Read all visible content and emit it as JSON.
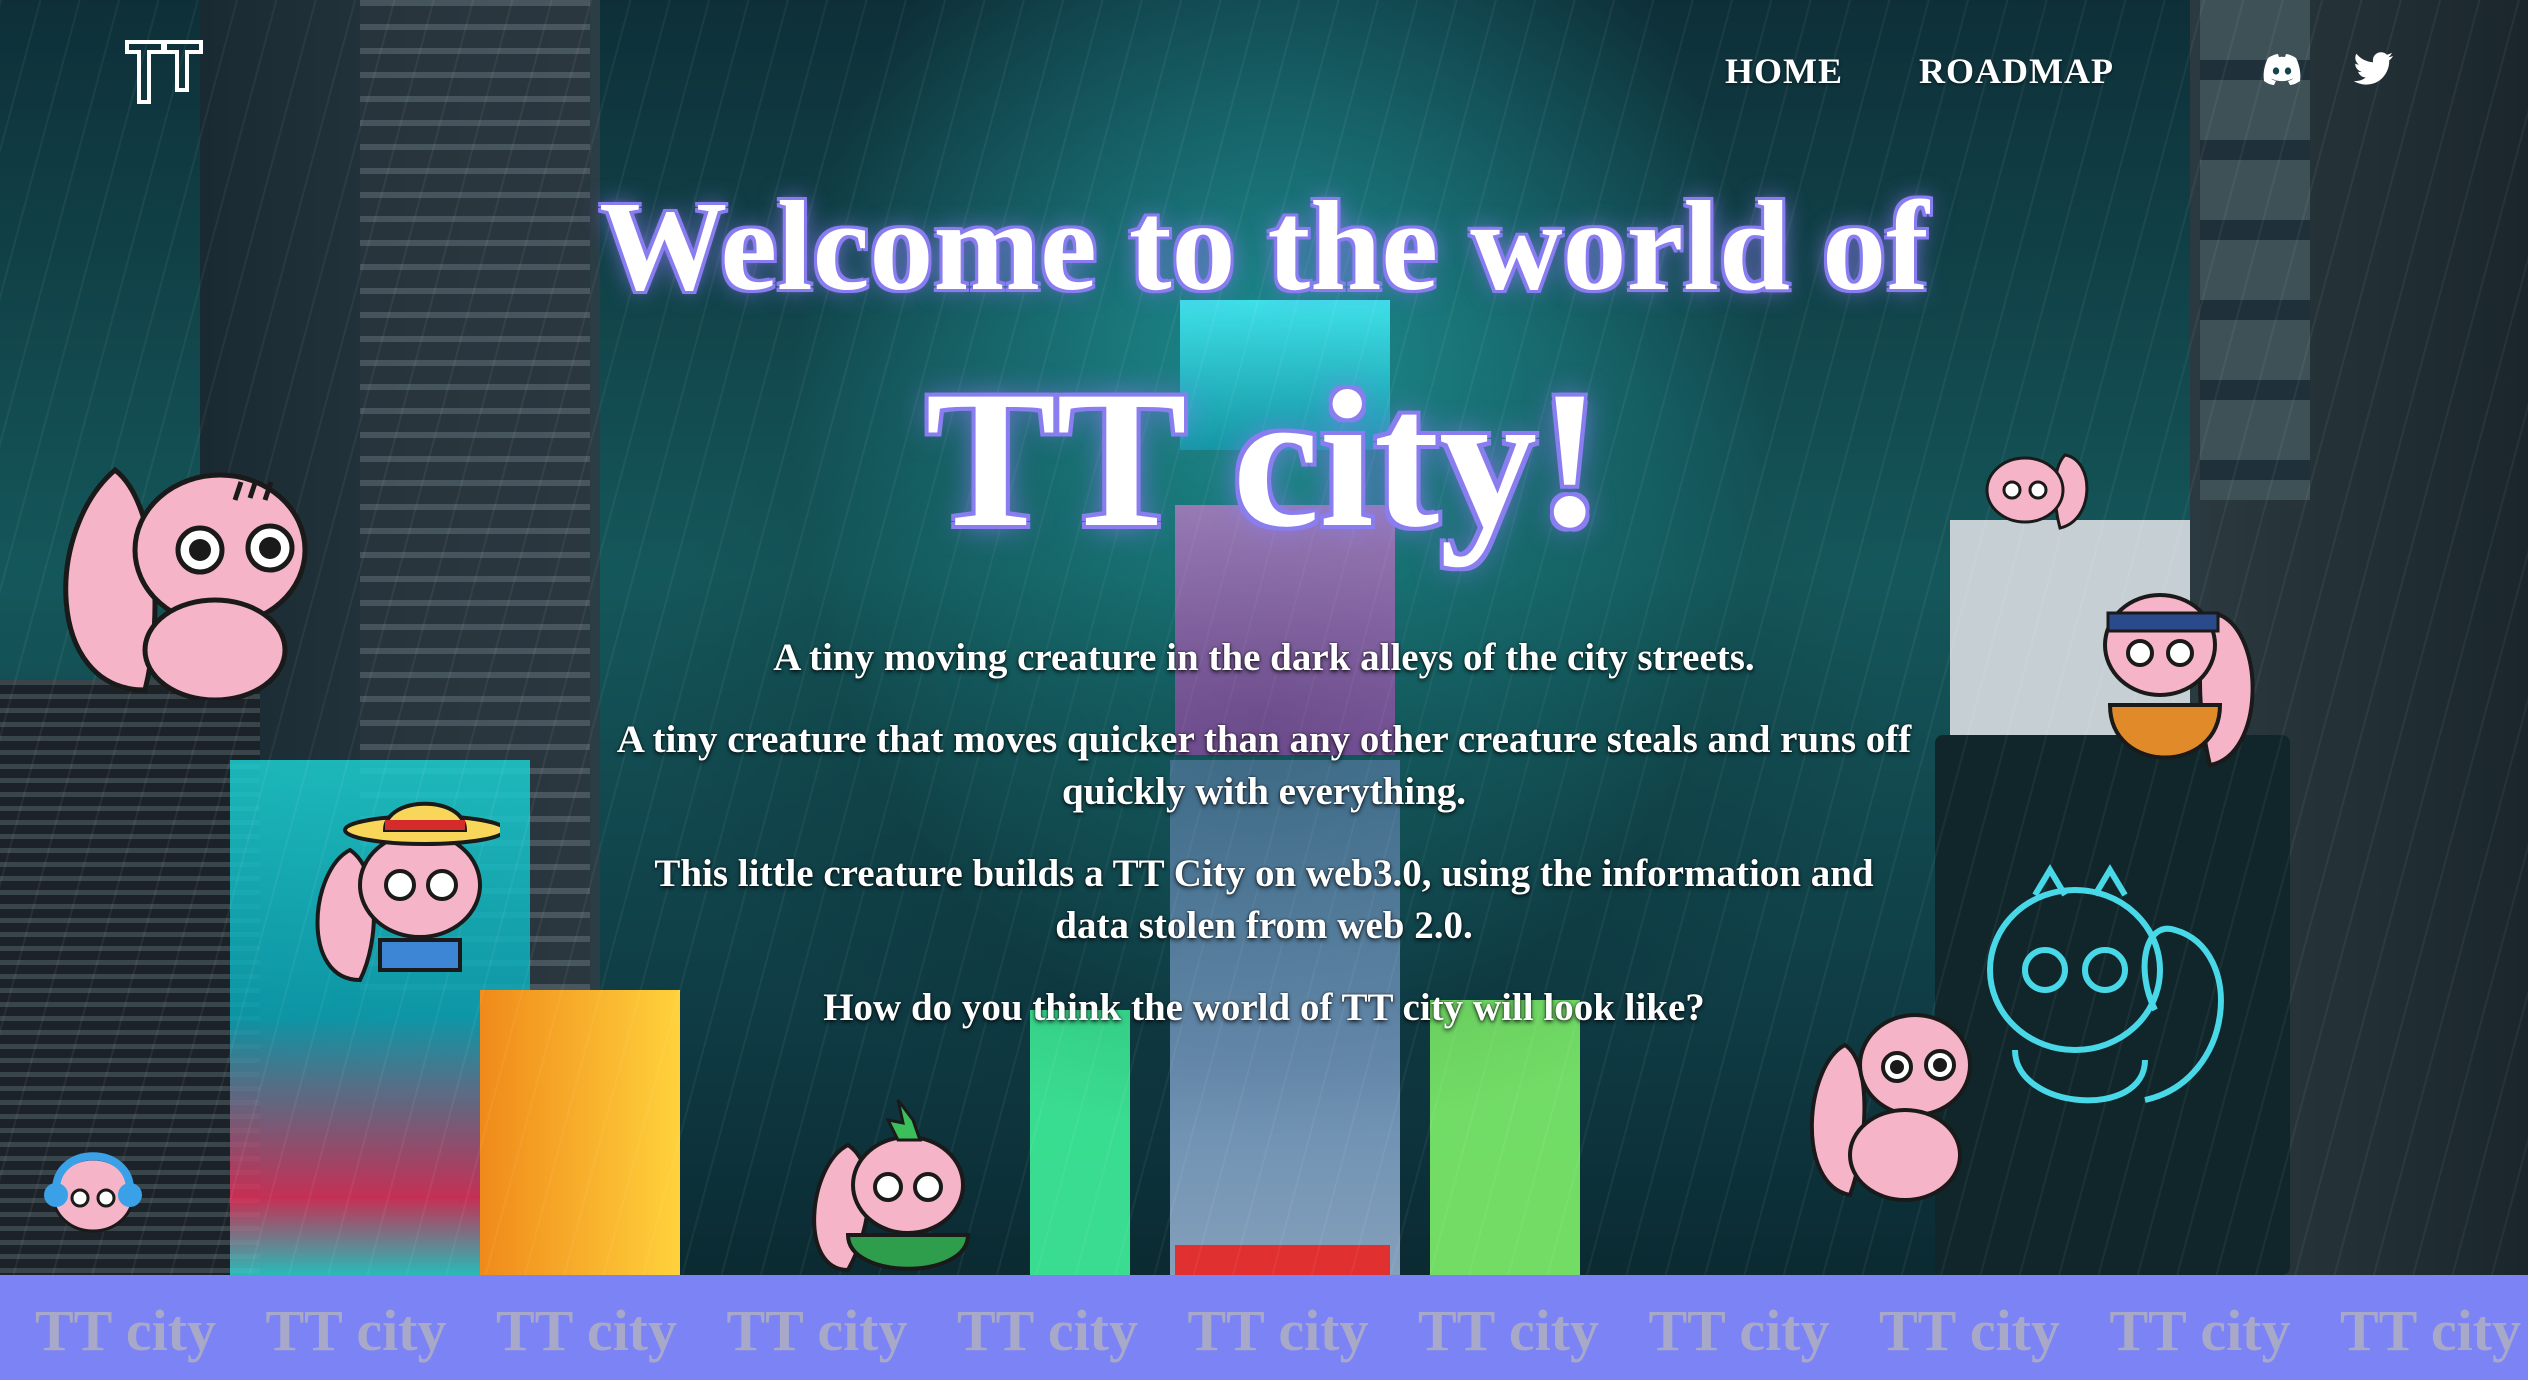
{
  "nav": {
    "logo_icon": "tt-logo-icon",
    "links": [
      {
        "label": "HOME"
      },
      {
        "label": "ROADMAP"
      }
    ],
    "social": [
      {
        "icon": "discord-icon"
      },
      {
        "icon": "twitter-icon"
      }
    ]
  },
  "hero": {
    "line1": "Welcome to the world of",
    "line2": "TT city!",
    "paragraphs": [
      "A tiny moving creature in the dark alleys of the city streets.",
      "A tiny creature that moves quicker than any other creature steals and runs off quickly with everything.",
      "This little creature builds a TT City on web3.0, using the information and data stolen from web 2.0.",
      "How do you think the world of TT city will look like?"
    ]
  },
  "marquee": {
    "text": "TT city",
    "repeat": 11
  },
  "colors": {
    "accent": "#8a7df0",
    "marquee_bg": "#7b83f5",
    "marquee_text": "#a8a9c9",
    "squirrel_pink": "#f5b4c8"
  }
}
